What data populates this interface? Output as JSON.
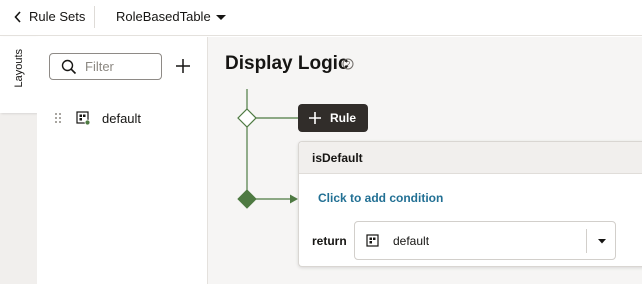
{
  "header": {
    "back_label": "Rule Sets",
    "page_name": "RoleBasedTable"
  },
  "tabs": {
    "layouts": "Layouts"
  },
  "panel": {
    "filter_placeholder": "Filter",
    "items": [
      {
        "label": "default"
      }
    ]
  },
  "main": {
    "title": "Display Logic",
    "rule_button": "Rule",
    "rule": {
      "name": "isDefault",
      "add_condition": "Click to add condition",
      "return_label": "return",
      "return_value": "default"
    }
  },
  "colors": {
    "flow_green": "#4e7a42",
    "link": "#227094",
    "dark_button": "#312d2a"
  }
}
